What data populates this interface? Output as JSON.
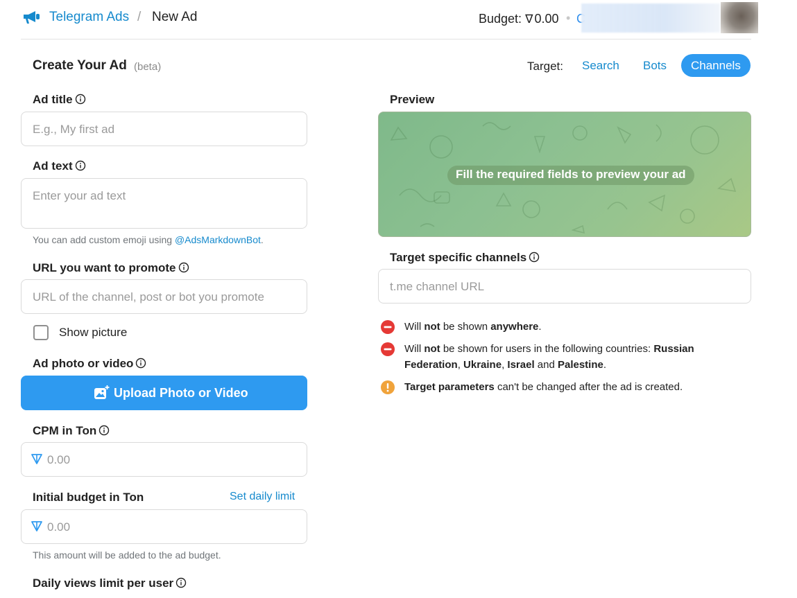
{
  "header": {
    "brand": "Telegram Ads",
    "separator": "/",
    "page": "New Ad",
    "budget_label": "Budget:",
    "budget_value": "0.00",
    "account_initial": "C",
    "dot": "•"
  },
  "create": {
    "title": "Create Your Ad",
    "beta": "(beta)"
  },
  "target": {
    "label": "Target:",
    "tabs": [
      {
        "label": "Search",
        "active": false
      },
      {
        "label": "Bots",
        "active": false
      },
      {
        "label": "Channels",
        "active": true
      }
    ]
  },
  "form": {
    "ad_title": {
      "label": "Ad title",
      "placeholder": "E.g., My first ad"
    },
    "ad_text": {
      "label": "Ad text",
      "placeholder": "Enter your ad text"
    },
    "emoji_hint": {
      "prefix": "You can add custom emoji using ",
      "link": "@AdsMarkdownBot",
      "suffix": "."
    },
    "url": {
      "label": "URL you want to promote",
      "placeholder": "URL of the channel, post or bot you promote"
    },
    "show_picture": {
      "label": "Show picture",
      "checked": false
    },
    "media": {
      "label": "Ad photo or video",
      "button": "Upload Photo or Video"
    },
    "cpm": {
      "label": "CPM in Ton",
      "placeholder": "0.00"
    },
    "budget": {
      "label": "Initial budget in Ton",
      "daily_link": "Set daily limit",
      "placeholder": "0.00",
      "hint": "This amount will be added to the ad budget."
    },
    "daily_views": {
      "label": "Daily views limit per user"
    }
  },
  "preview": {
    "label": "Preview",
    "placeholder": "Fill the required fields to preview your ad"
  },
  "channels": {
    "label": "Target specific channels",
    "placeholder": "t.me channel URL"
  },
  "notices": {
    "n1": {
      "a": "Will ",
      "b": "not",
      "c": " be shown ",
      "d": "anywhere",
      "e": "."
    },
    "n2": {
      "a": "Will ",
      "b": "not",
      "c": " be shown for users in the following countries: ",
      "d": "Russian Federation",
      "e": ", ",
      "f": "Ukraine",
      "g": ", ",
      "h": "Israel",
      "i": " and ",
      "j": "Palestine",
      "k": "."
    },
    "n3": {
      "a": "Target parameters",
      "b": " can't be changed after the ad is created."
    }
  },
  "colors": {
    "accent": "#2e9af0",
    "link": "#168acd",
    "error": "#e53935",
    "warning": "#f0a33b"
  },
  "icons": {
    "logo": "megaphone-icon",
    "info": "info-icon",
    "ton": "ton-icon",
    "upload": "add-photo-icon",
    "forbidden": "minus-circle-icon",
    "warning": "exclamation-icon"
  }
}
